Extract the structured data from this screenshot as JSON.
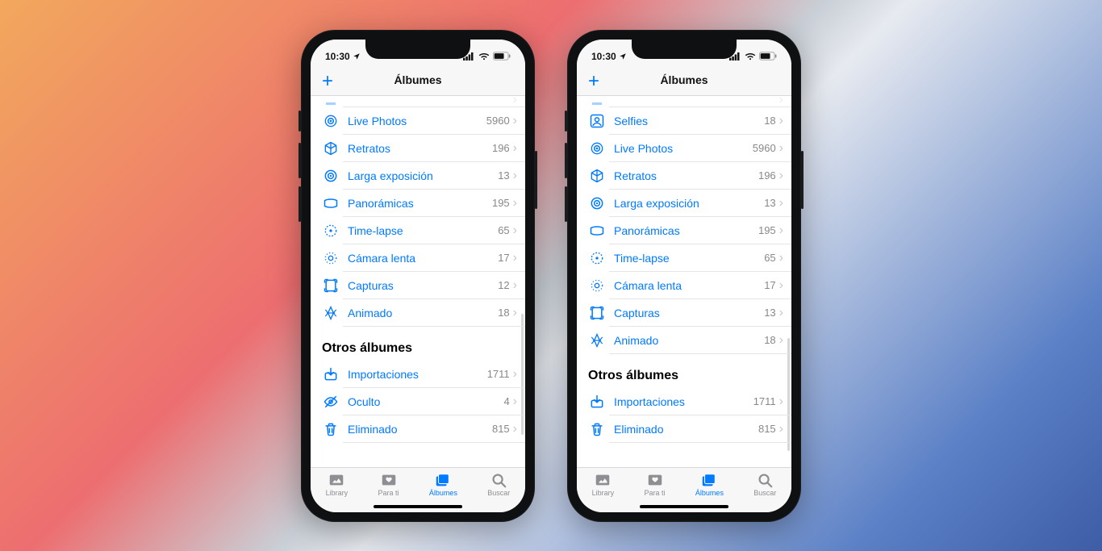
{
  "status": {
    "time": "10:30"
  },
  "nav": {
    "title": "Álbumes"
  },
  "section_other": "Otros álbumes",
  "tabs": {
    "library": "Library",
    "for_you": "Para ti",
    "albums": "Álbumes",
    "search": "Buscar"
  },
  "left": {
    "cut_label": "",
    "rows": [
      {
        "label": "Live Photos",
        "count": "5960"
      },
      {
        "label": "Retratos",
        "count": "196"
      },
      {
        "label": "Larga exposición",
        "count": "13"
      },
      {
        "label": "Panorámicas",
        "count": "195"
      },
      {
        "label": "Time-lapse",
        "count": "65"
      },
      {
        "label": "Cámara lenta",
        "count": "17"
      },
      {
        "label": "Capturas",
        "count": "12"
      },
      {
        "label": "Animado",
        "count": "18"
      }
    ],
    "other": [
      {
        "label": "Importaciones",
        "count": "1711"
      },
      {
        "label": "Oculto",
        "count": "4"
      },
      {
        "label": "Eliminado",
        "count": "815"
      }
    ]
  },
  "right": {
    "cut_label": "",
    "rows": [
      {
        "label": "Selfies",
        "count": "18"
      },
      {
        "label": "Live Photos",
        "count": "5960"
      },
      {
        "label": "Retratos",
        "count": "196"
      },
      {
        "label": "Larga exposición",
        "count": "13"
      },
      {
        "label": "Panorámicas",
        "count": "195"
      },
      {
        "label": "Time-lapse",
        "count": "65"
      },
      {
        "label": "Cámara lenta",
        "count": "17"
      },
      {
        "label": "Capturas",
        "count": "13"
      },
      {
        "label": "Animado",
        "count": "18"
      }
    ],
    "other": [
      {
        "label": "Importaciones",
        "count": "1711"
      },
      {
        "label": "Eliminado",
        "count": "815"
      }
    ]
  },
  "icons": {
    "Selfies": "selfie",
    "Live Photos": "livephoto",
    "Retratos": "cube",
    "Larga exposición": "longexp",
    "Panorámicas": "pano",
    "Time-lapse": "timelapse",
    "Cámara lenta": "slowmo",
    "Capturas": "screenshot",
    "Animado": "animated",
    "Importaciones": "import",
    "Oculto": "hidden",
    "Eliminado": "trash"
  }
}
